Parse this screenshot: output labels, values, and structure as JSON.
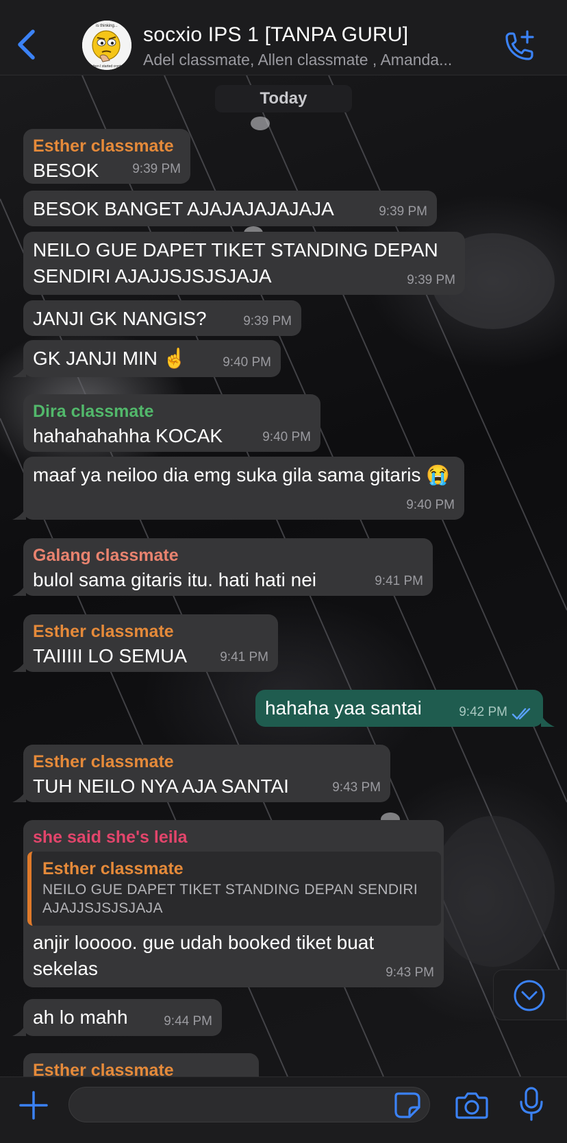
{
  "header": {
    "title": "socxio IPS 1 [TANPA GURU]",
    "members": "Adel classmate, Allen classmate , Amanda...",
    "avatar_caption_top": "is thinking...",
    "avatar_caption_bottom": "when I started crypto"
  },
  "date_chip": "Today",
  "colors": {
    "accent": "#3b82f6",
    "outgoing_bubble": "#1f5c4f",
    "incoming_bubble": "#363638",
    "esther": "#e58a3a",
    "dira": "#52b86b",
    "galang": "#e9836f",
    "leila": "#e2456b"
  },
  "messages": [
    {
      "sender": "Esther classmate",
      "text": "BESOK",
      "time": "9:39 PM"
    },
    {
      "text": "BESOK BANGET AJAJAJAJAJAJA",
      "time": "9:39 PM"
    },
    {
      "text": "NEILO GUE DAPET TIKET STANDING DEPAN SENDIRI AJAJJSJSJSJAJA",
      "time": "9:39 PM"
    },
    {
      "text": "JANJI GK NANGIS?",
      "time": "9:39 PM"
    },
    {
      "text": "GK JANJI MIN ☝️",
      "time": "9:40 PM"
    },
    {
      "sender": "Dira classmate",
      "text": "hahahahahha KOCAK",
      "time": "9:40 PM"
    },
    {
      "text": "maaf ya neiloo dia emg suka gila sama gitaris 😭",
      "time": "9:40 PM"
    },
    {
      "sender": "Galang classmate",
      "text": "bulol sama gitaris itu. hati hati nei",
      "time": "9:41 PM"
    },
    {
      "sender": "Esther classmate",
      "text": "TAIIIII LO SEMUA",
      "time": "9:41 PM"
    },
    {
      "text": "hahaha yaa santai",
      "time": "9:42 PM"
    },
    {
      "sender": "Esther classmate",
      "text": "TUH NEILO NYA AJA SANTAI",
      "time": "9:43 PM"
    },
    {
      "sender": "she said she's leila",
      "quote_sender": "Esther classmate",
      "quote_text": "NEILO GUE DAPET TIKET STANDING DEPAN SENDIRI AJAJJSJSJSJAJA",
      "text": "anjir looooo. gue udah booked tiket buat sekelas",
      "time": "9:43 PM"
    },
    {
      "text": "ah lo mahh",
      "time": "9:44 PM"
    },
    {
      "sender": "Esther classmate"
    }
  ],
  "input": {
    "value": "",
    "placeholder": ""
  },
  "icons": {
    "back": "chevron-left-icon",
    "call": "add-call-icon",
    "attach": "plus-icon",
    "sticker": "sticker-icon",
    "camera": "camera-icon",
    "mic": "mic-icon",
    "scroll": "chevron-down-circle-icon",
    "read": "double-check-icon"
  }
}
